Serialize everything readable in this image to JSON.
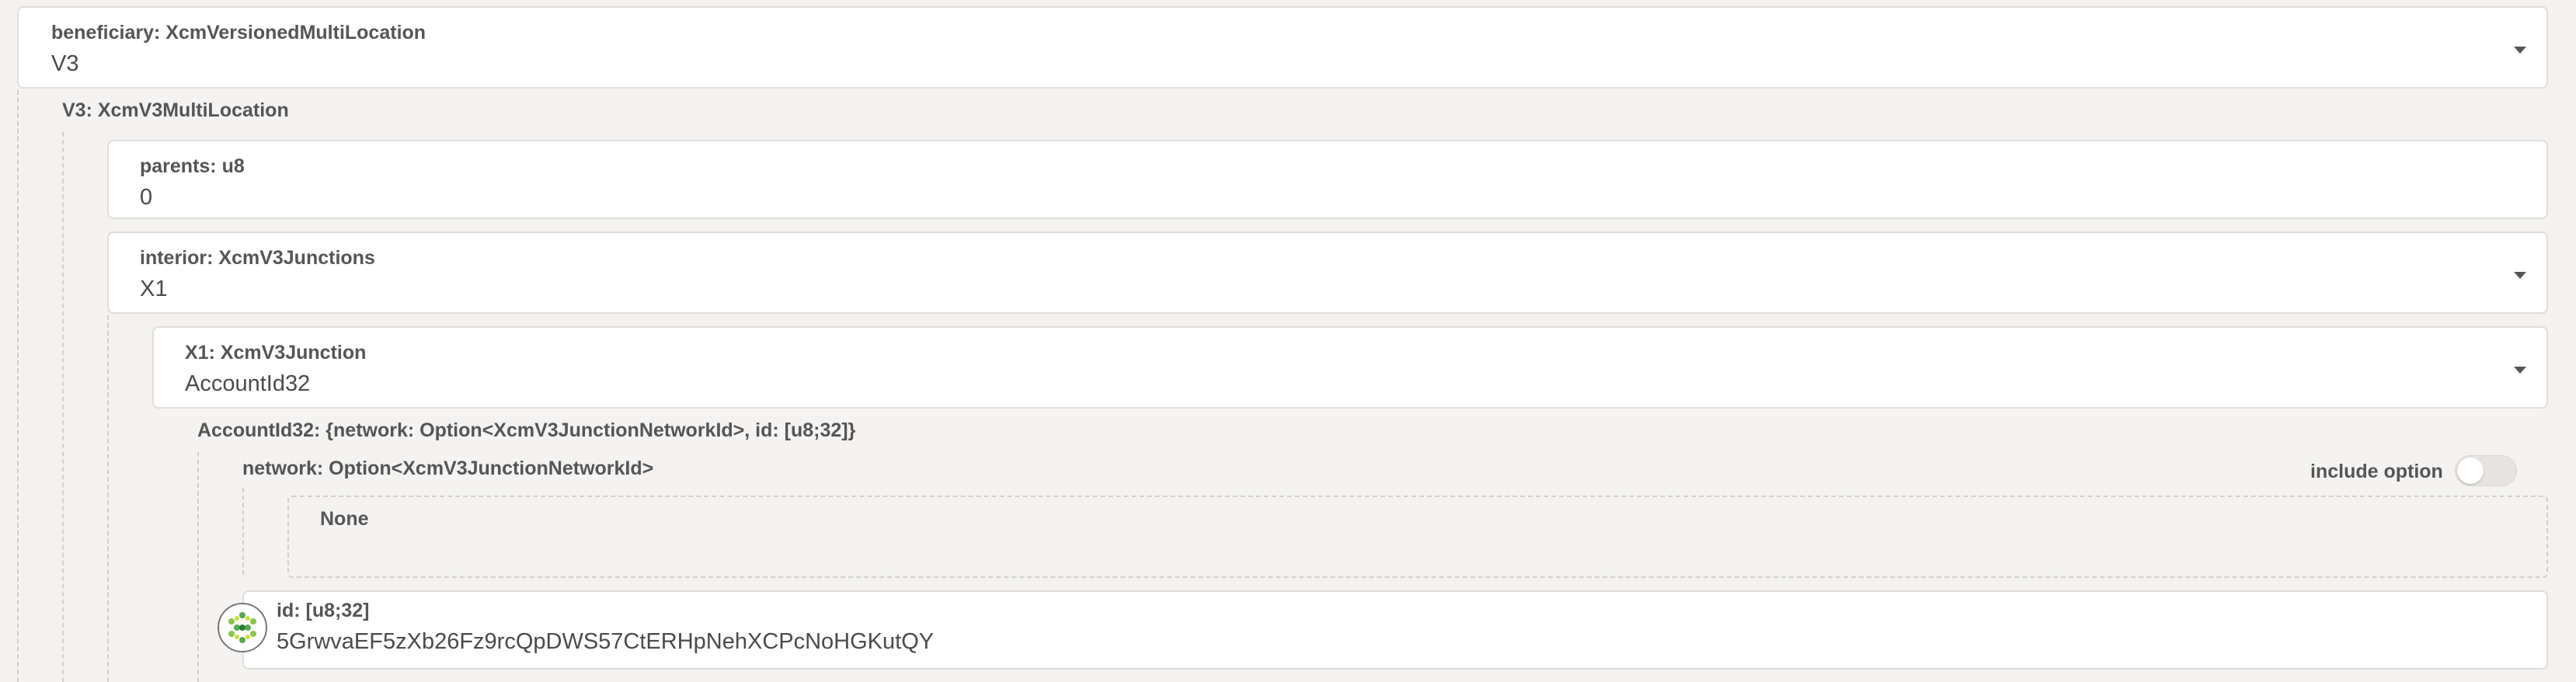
{
  "beneficiary": {
    "label": "beneficiary: XcmVersionedMultiLocation",
    "value": "V3"
  },
  "v3": {
    "label": "V3: XcmV3MultiLocation",
    "parents": {
      "label": "parents: u8",
      "value": "0"
    },
    "interior": {
      "label": "interior: XcmV3Junctions",
      "value": "X1"
    },
    "x1": {
      "label": "X1: XcmV3Junction",
      "value": "AccountId32"
    },
    "account_id32": {
      "label": "AccountId32: {network: Option<XcmV3JunctionNetworkId>, id: [u8;32]}",
      "network": {
        "label": "network: Option<XcmV3JunctionNetworkId>",
        "include_option_label": "include option",
        "include_option_enabled": false,
        "none_label": "None"
      },
      "id": {
        "label": "id: [u8;32]",
        "value": "5GrwvaEF5zXb26Fz9rcQpDWS57CtERHpNehXCPcNoHGKutQY",
        "icon": "identicon-icon"
      }
    }
  }
}
